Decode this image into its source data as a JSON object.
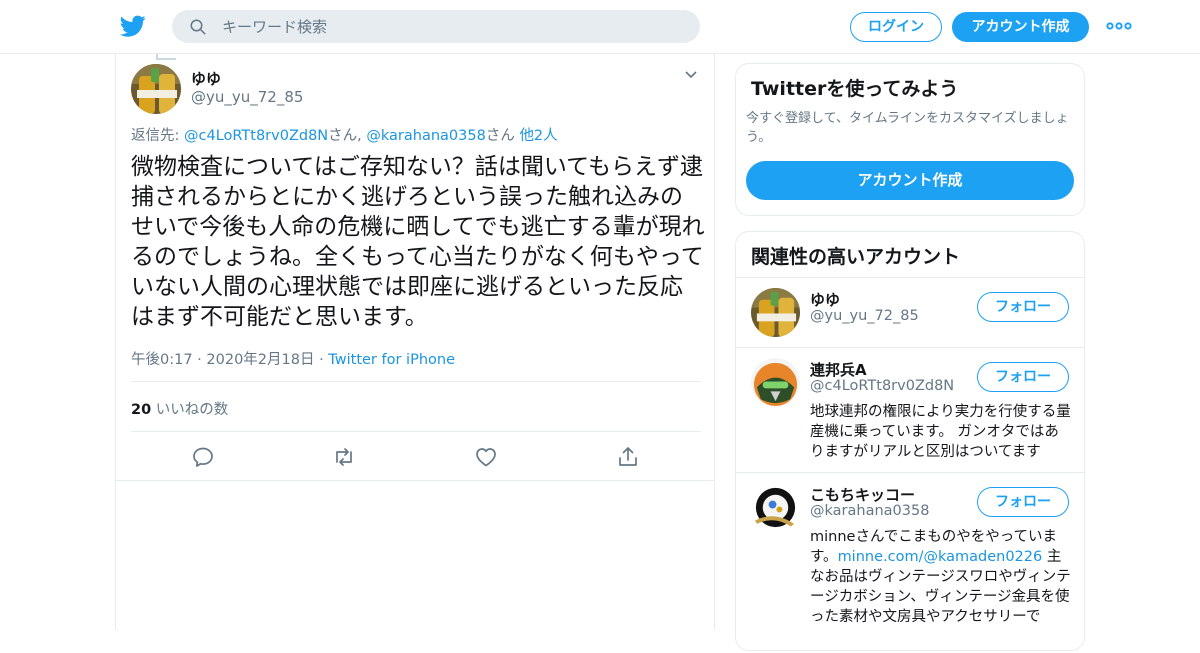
{
  "header": {
    "search_placeholder": "キーワード検索",
    "login_label": "ログイン",
    "signup_label": "アカウント作成",
    "brand_color": "#1da1f2"
  },
  "tweet": {
    "author_name": "ゆゆ",
    "author_handle": "@yu_yu_72_85",
    "replying_prefix": "返信先: ",
    "replying_user1": "@c4LoRTt8rv0Zd8N",
    "replying_san1": "さん, ",
    "replying_user2": "@karahana0358",
    "replying_san2": "さん ",
    "replying_others": "他2人",
    "text": "微物検査についてはご存知ない？話は聞いてもらえず逮捕されるからとにかく逃げろという誤った触れ込みのせいで今後も人命の危機に晒してでも逃亡する輩が現れるのでしょうね。全くもって心当たりがなく何もやっていない人間の心理状態では即座に逃げるといった反応はまず不可能だと思います。",
    "time": "午後0:17 · 2020年2月18日 · ",
    "source": "Twitter for iPhone",
    "likes_count": "20",
    "likes_label": " いいねの数"
  },
  "signup_card": {
    "title": "Twitterを使ってみよう",
    "description": "今すぐ登録して、タイムラインをカスタマイズしましょう。",
    "button_label": "アカウント作成"
  },
  "related": {
    "title": "関連性の高いアカウント",
    "follow_label": "フォロー",
    "accounts": [
      {
        "name": "ゆゆ",
        "handle": "@yu_yu_72_85",
        "bio": ""
      },
      {
        "name": "連邦兵A",
        "handle": "@c4LoRTt8rv0Zd8N",
        "bio": "地球連邦の権限により実力を行使する量産機に乗っています。 ガンオタではありますがリアルと区別はついてます"
      },
      {
        "name": "こもちキッコー",
        "handle": "@karahana0358",
        "bio_pre": "minneさんでこまものやをやっています。",
        "bio_link": "minne.com/@kamaden0226",
        "bio_post": " 主なお品はヴィンテージスワロやヴィンテージカボション、ヴィンテージ金具を使った素材や文房具やアクセサリーで"
      }
    ]
  }
}
